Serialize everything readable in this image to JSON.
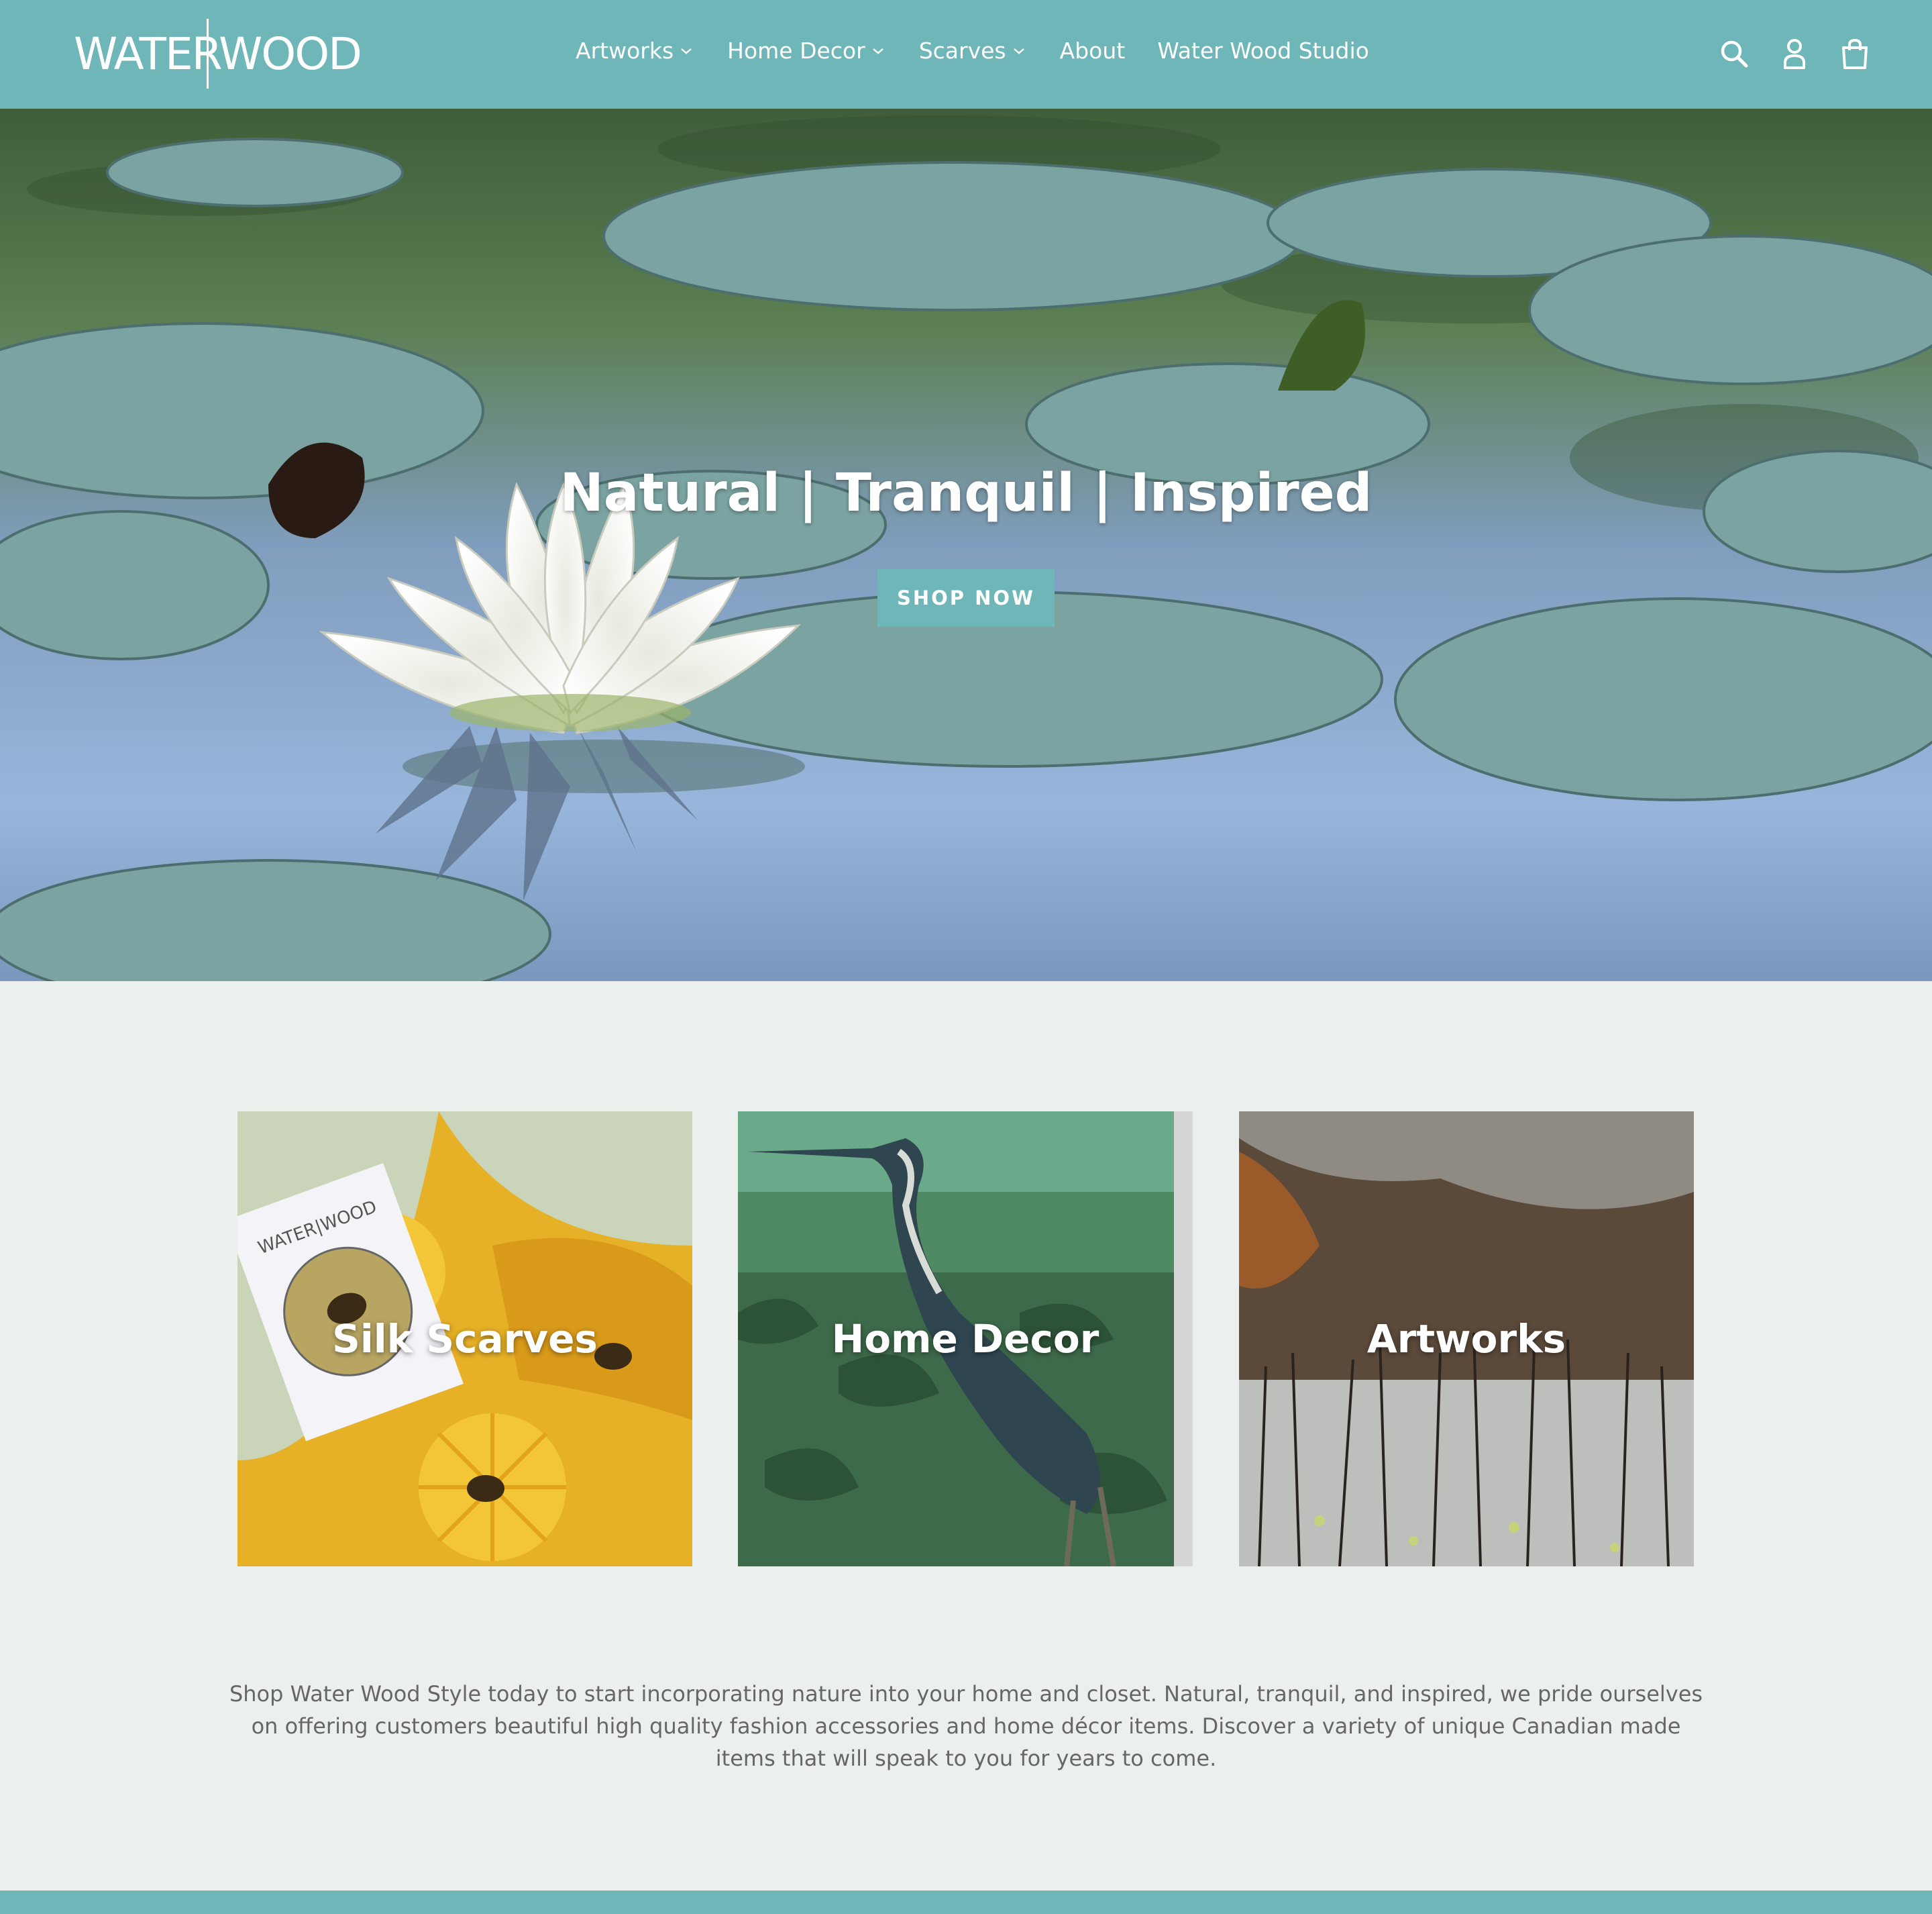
{
  "brand": {
    "logo_left": "WATER",
    "logo_right": "WOOD",
    "accent_color": "#6eb6b7",
    "background_color": "#ebf0ef"
  },
  "nav": {
    "items": [
      {
        "label": "Artworks",
        "has_dropdown": true
      },
      {
        "label": "Home Decor",
        "has_dropdown": true
      },
      {
        "label": "Scarves",
        "has_dropdown": true
      },
      {
        "label": "About",
        "has_dropdown": false
      },
      {
        "label": "Water Wood Studio",
        "has_dropdown": false
      }
    ]
  },
  "header_icons": [
    "search-icon",
    "account-icon",
    "cart-icon"
  ],
  "hero": {
    "title": "Natural | Tranquil | Inspired",
    "button": "SHOP NOW"
  },
  "collections": [
    {
      "title": "Silk Scarves",
      "card_logo": "WATER|WOOD"
    },
    {
      "title": "Home Decor"
    },
    {
      "title": "Artworks"
    }
  ],
  "intro": {
    "text": "Shop Water Wood Style today to start incorporating nature into your home and closet. Natural, tranquil, and inspired, we pride ourselves on offering customers beautiful high quality fashion accessories and home décor items. Discover a variety of unique Canadian made items that will speak to you for years to come."
  }
}
